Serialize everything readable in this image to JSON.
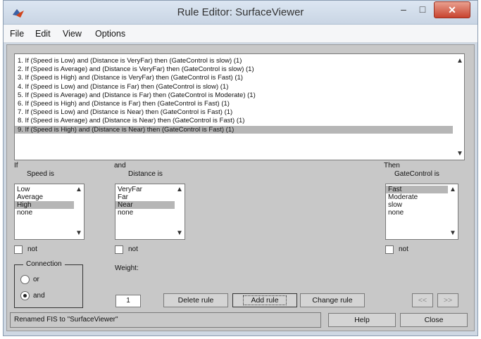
{
  "window": {
    "title": "Rule Editor: SurfaceViewer",
    "controls": {
      "minimize": "–",
      "maximize": "□",
      "close": "✕"
    }
  },
  "menu": [
    "File",
    "Edit",
    "View",
    "Options"
  ],
  "rules": [
    "1. If (Speed is Low) and (Distance is VeryFar) then (GateControl is slow) (1)",
    "2. If (Speed is Average) and (Distance is VeryFar) then (GateControl is slow) (1)",
    "3. If (Speed is High) and (Distance is VeryFar) then (GateControl is Fast) (1)",
    "4. If (Speed is Low) and (Distance is Far) then (GateControl is slow) (1)",
    "5. If (Speed is Average) and (Distance is Far) then (GateControl is Moderate) (1)",
    "6. If (Speed is High) and (Distance is Far) then (GateControl is Fast) (1)",
    "7. If (Speed is Low) and (Distance is Near) then (GateControl is Fast) (1)",
    "8. If (Speed is Average) and (Distance is Near) then (GateControl is Fast) (1)",
    "9. If (Speed is High) and (Distance is Near) then (GateControl is Fast) (1)"
  ],
  "selected_rule": 9,
  "antecedents": {
    "if_label": "If",
    "speed_label": "Speed is",
    "and_label": "and",
    "distance_label": "Distance is"
  },
  "speed": {
    "options": [
      "Low",
      "Average",
      "High",
      "none"
    ],
    "selected": "High"
  },
  "distance": {
    "options": [
      "VeryFar",
      "Far",
      "Near",
      "none"
    ],
    "selected": "Near"
  },
  "consequent": {
    "then_label": "Then",
    "label": "GateControl is",
    "options": [
      "Fast",
      "Moderate",
      "slow",
      "none"
    ],
    "selected": "Fast"
  },
  "not_label": "not",
  "connection": {
    "title": "Connection",
    "options": [
      "or",
      "and"
    ],
    "selected": "and"
  },
  "weight": {
    "label": "Weight:",
    "value": "1"
  },
  "buttons": {
    "delete_rule": "Delete rule",
    "add_rule": "Add rule",
    "change_rule": "Change rule",
    "prev": "<<",
    "next": ">>",
    "help": "Help",
    "close": "Close"
  },
  "status": "Renamed FIS to \"SurfaceViewer\"",
  "colors": {
    "titlebar": "#cfdbea",
    "close_button": "#c8432f",
    "panel": "#c8c8c8",
    "selection": "#b6b6b6"
  }
}
